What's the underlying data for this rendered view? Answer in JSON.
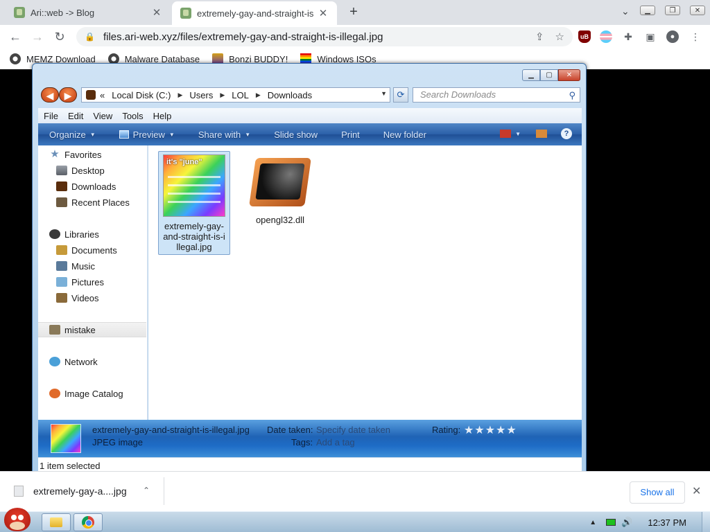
{
  "browser": {
    "tabs": [
      {
        "title": "Ari::web -> Blog",
        "active": false
      },
      {
        "title": "extremely-gay-and-straight-is",
        "active": true
      }
    ],
    "url": "files.ari-web.xyz/files/extremely-gay-and-straight-is-illegal.jpg",
    "bookmarks": [
      "MEMZ Download",
      "Malware Database",
      "Bonzi BUDDY!",
      "Windows ISOs"
    ]
  },
  "explorer": {
    "breadcrumb": {
      "prefix": "«",
      "items": [
        "Local Disk (C:)",
        "Users",
        "LOL",
        "Downloads"
      ]
    },
    "search_placeholder": "Search Downloads",
    "menu": [
      "File",
      "Edit",
      "View",
      "Tools",
      "Help"
    ],
    "commands": {
      "organize": "Organize",
      "preview": "Preview",
      "share_with": "Share with",
      "slide_show": "Slide show",
      "print": "Print",
      "new_folder": "New folder"
    },
    "nav": {
      "favorites": "Favorites",
      "desktop": "Desktop",
      "downloads": "Downloads",
      "recent": "Recent Places",
      "libraries": "Libraries",
      "documents": "Documents",
      "music": "Music",
      "pictures": "Pictures",
      "videos": "Videos",
      "mistake": "mistake",
      "network": "Network",
      "image_catalog": "Image Catalog"
    },
    "files": [
      {
        "name": "extremely-gay-and-straight-is-illegal.jpg",
        "lines": [
          "extremely-gay-",
          "and-straight-is-i",
          "llegal.jpg"
        ],
        "selected": true,
        "thumb_text": "it's \"june\""
      },
      {
        "name": "opengl32.dll",
        "lines": [
          "opengl32.dll"
        ],
        "selected": false
      }
    ],
    "details": {
      "filename": "extremely-gay-and-straight-is-illegal.jpg",
      "type": "JPEG image",
      "date_label": "Date taken:",
      "date_value": "Specify date taken",
      "tags_label": "Tags:",
      "tags_value": "Add a tag",
      "rating_label": "Rating:",
      "rating_stars": "★★★★★",
      "rating": 0
    },
    "status": "1 item selected"
  },
  "downloads_shelf": {
    "item": "extremely-gay-a....jpg",
    "show_all": "Show all"
  },
  "taskbar": {
    "clock": "12:37 PM"
  },
  "colors": {
    "command_bar": "#2b5fa8",
    "selection": "#cde4f7",
    "chrome_link": "#1a73e8"
  }
}
